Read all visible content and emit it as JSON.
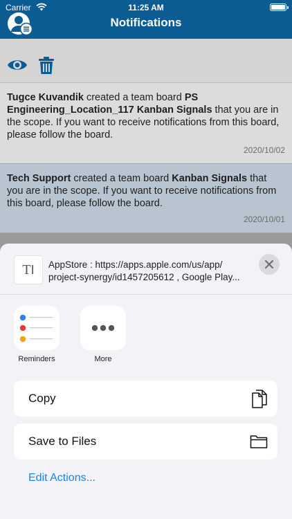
{
  "status_bar": {
    "carrier": "Carrier",
    "time": "11:25 AM"
  },
  "header": {
    "title": "Notifications"
  },
  "toolbar": {
    "icons": [
      "eye-icon",
      "trash-icon"
    ]
  },
  "notifications": [
    {
      "sender": "Tugce Kuvandik",
      "action": " created a team board ",
      "board": "PS Engineering_Location_117 Kanban Signals",
      "rest": " that you are in the scope. If you want to receive notifications from this board, please follow the board.",
      "date": "2020/10/02"
    },
    {
      "sender": "Tech Support",
      "action": " created a team board ",
      "board": "Kanban Signals",
      "rest": " that you are in the scope. If you want to receive notifications from this board, please follow the board.",
      "date": "2020/10/01"
    }
  ],
  "share_sheet": {
    "shared_text_line1": "AppStore : https://apps.apple.com/us/app/",
    "shared_text_line2": "project-synergy/id1457205612  ,  Google Play...",
    "apps": [
      {
        "label": "Reminders",
        "icon": "reminders-icon"
      },
      {
        "label": "More",
        "icon": "more-icon"
      }
    ],
    "actions": [
      {
        "label": "Copy",
        "icon": "copy-icon"
      },
      {
        "label": "Save to Files",
        "icon": "folder-icon"
      }
    ],
    "edit_actions_label": "Edit Actions..."
  },
  "colors": {
    "header_bg": "#0a5c93",
    "accent_icon": "#0a5c93",
    "link_blue": "#1f82e4",
    "reminder_dots": [
      "#2d7ef7",
      "#e33b30",
      "#f4a516"
    ]
  }
}
